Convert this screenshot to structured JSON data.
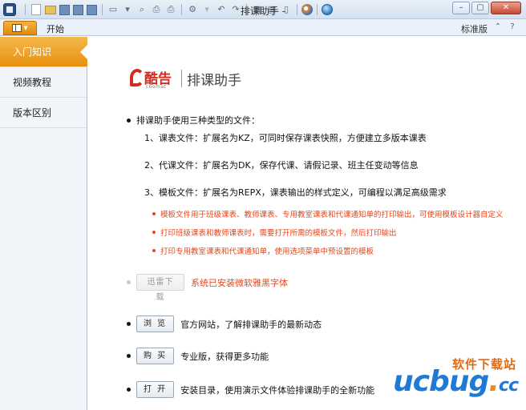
{
  "window": {
    "title": "排课助手 -"
  },
  "ribbon": {
    "tab_start": "开始",
    "view_label": "标准版"
  },
  "nav": {
    "items": [
      {
        "label": "入门知识"
      },
      {
        "label": "视频教程"
      },
      {
        "label": "版本区别"
      }
    ]
  },
  "logo": {
    "brand_cn": "酷告",
    "brand_en": "coomat",
    "title": "排课助手"
  },
  "intro": "排课助手使用三种类型的文件：",
  "file_types": [
    "1、课表文件：扩展名为KZ，可同时保存课表快照，方便建立多版本课表",
    "2、代课文件：扩展名为DK，保存代课、请假记录、班主任变动等信息",
    "3、模板文件：扩展名为REPX，课表输出的样式定义，可编程以满足高级需求"
  ],
  "notes": [
    "模板文件用于班级课表、教师课表、专用教室课表和代课通知单的打印输出，可使用模板设计器自定义",
    "打印班级课表和教师课表时，需要打开所需的模板文件，然后打印输出",
    "打印专用教室课表和代课通知单，使用选项菜单中预设置的模板"
  ],
  "font_row": {
    "button": "迅雷下载",
    "status": "系统已安装微软雅黑字体"
  },
  "actions": [
    {
      "button": "浏 览",
      "text": "官方网站，了解排课助手的最新动态"
    },
    {
      "button": "购 买",
      "text": "专业版，获得更多功能"
    },
    {
      "button": "打 开",
      "text": "安装目录，使用演示文件体验排课助手的全新功能"
    }
  ],
  "watermark": {
    "top": "软件下载站",
    "brand_a": "ucbug",
    "brand_dot": ".",
    "brand_b": "cc"
  },
  "colors": {
    "accent_orange": "#e6900f",
    "note_red": "#e3481f",
    "brand_red": "#d62a1e"
  }
}
